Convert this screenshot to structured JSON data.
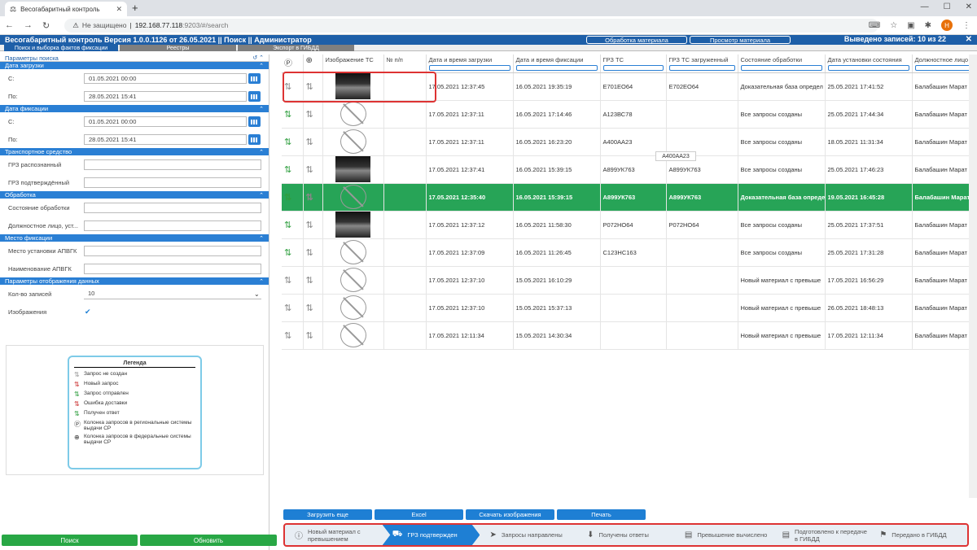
{
  "browser": {
    "tab_title": "Весогабаритный контроль",
    "security": "Не защищено",
    "url_host": "192.168.77.118",
    "url_path": ":9203/#/search",
    "avatar": "H"
  },
  "header": {
    "title": "Весогабаритный контроль Версия 1.0.0.1126 от 26.05.2021 || Поиск || Администратор",
    "btn_process": "Обработка материала",
    "btn_view": "Просмотр материала",
    "count": "Выведено записей: 10 из 22",
    "close": "✕"
  },
  "subtabs": [
    "Поиск и выборка фактов фиксации",
    "Реестры",
    "Экспорт в ГИБДД"
  ],
  "left": {
    "params_title": "Параметры поиска",
    "upload_section": "Дата загрузки",
    "from_label": "С:",
    "to_label": "По:",
    "upload_from": "01.05.2021 00:00",
    "upload_to": "28.05.2021 15:41",
    "fix_section": "Дата фиксации",
    "fix_from": "01.05.2021 00:00",
    "fix_to": "28.05.2021 15:41",
    "vehicle_section": "Транспортное средство",
    "grz_recognized": "ГРЗ распознанный",
    "grz_confirmed": "ГРЗ подтверждённый",
    "processing_section": "Обработка",
    "proc_state": "Состояние обработки",
    "official": "Должностное лицо, уст...",
    "place_section": "Место фиксации",
    "place_install": "Место установки АПВГК",
    "place_name": "Наименование АПВГК",
    "display_section": "Параметры отображения данных",
    "count_label": "Кол-во записей",
    "count_value": "10",
    "images_label": "Изображения",
    "legend_title": "Легенда",
    "legend": [
      "Запрос не создан",
      "Новый запрос",
      "Запрос отправлен",
      "Ошибка доставки",
      "Получен ответ",
      "Колонка запросов в региональные системы выдачи СР",
      "Колонка запросов в федеральные системы выдачи СР"
    ],
    "search_btn": "Поиск",
    "refresh_btn": "Обновить"
  },
  "table": {
    "columns": [
      "",
      "",
      "Изображение ТС",
      "№ п/п",
      "Дата и время загрузки",
      "Дата и время фиксации",
      "ГРЗ ТС",
      "ГРЗ ТС загруженный",
      "Состояние обработки",
      "Дата установки состояния",
      "Должностное лицо"
    ],
    "rows": [
      {
        "img": "photo",
        "a1": "",
        "a2": "",
        "load": "17.05.2021 12:37:45",
        "fix": "16.05.2021 19:35:19",
        "grz": "Е701ЕО64",
        "grz2": "Е702ЕО64",
        "state": "Доказательная база определ",
        "sdate": "25.05.2021 17:41:52",
        "off": "Балабашин Марат"
      },
      {
        "img": "none",
        "a1": "g",
        "a2": "",
        "load": "17.05.2021 12:37:11",
        "fix": "16.05.2021 17:14:46",
        "grz": "А123ВС78",
        "grz2": "",
        "state": "Все запросы созданы",
        "sdate": "25.05.2021 17:44:34",
        "off": "Балабашин Марат"
      },
      {
        "img": "none",
        "a1": "g",
        "a2": "",
        "load": "17.05.2021 12:37:11",
        "fix": "16.05.2021 16:23:20",
        "grz": "А400АА23",
        "grz2": "",
        "state": "Все запросы созданы",
        "sdate": "18.05.2021 11:31:34",
        "off": "Балабашин Марат"
      },
      {
        "img": "photo",
        "a1": "g",
        "a2": "",
        "load": "17.05.2021 12:37:41",
        "fix": "16.05.2021 15:39:15",
        "grz": "А899УК763",
        "grz2": "А899УК763",
        "state": "Все запросы созданы",
        "sdate": "25.05.2021 17:46:23",
        "off": "Балабашин Марат"
      },
      {
        "img": "none",
        "a1": "g",
        "a2": "",
        "load": "17.05.2021 12:35:40",
        "fix": "16.05.2021 15:39:15",
        "grz": "А899УК763",
        "grz2": "А899УК763",
        "state": "Доказательная база определ",
        "sdate": "19.05.2021 16:45:28",
        "off": "Балабашин Марат",
        "sel": true
      },
      {
        "img": "photo",
        "a1": "g",
        "a2": "",
        "load": "17.05.2021 12:37:12",
        "fix": "16.05.2021 11:58:30",
        "grz": "Р072НО64",
        "grz2": "Р072НО64",
        "state": "Все запросы созданы",
        "sdate": "25.05.2021 17:37:51",
        "off": "Балабашин Марат"
      },
      {
        "img": "none",
        "a1": "g",
        "a2": "",
        "load": "17.05.2021 12:37:09",
        "fix": "16.05.2021 11:26:45",
        "grz": "С123НС163",
        "grz2": "",
        "state": "Все запросы созданы",
        "sdate": "25.05.2021 17:31:28",
        "off": "Балабашин Марат"
      },
      {
        "img": "none",
        "a1": "",
        "a2": "",
        "load": "17.05.2021 12:37:10",
        "fix": "15.05.2021 16:10:29",
        "grz": "",
        "grz2": "",
        "state": "Новый материал с превыше",
        "sdate": "17.05.2021 16:56:29",
        "off": "Балабашин Марат"
      },
      {
        "img": "none",
        "a1": "",
        "a2": "",
        "load": "17.05.2021 12:37:10",
        "fix": "15.05.2021 15:37:13",
        "grz": "",
        "grz2": "",
        "state": "Новый материал с превыше",
        "sdate": "26.05.2021 18:48:13",
        "off": "Балабашин Марат"
      },
      {
        "img": "none",
        "a1": "",
        "a2": "",
        "load": "17.05.2021 12:11:34",
        "fix": "15.05.2021 14:30:34",
        "grz": "",
        "grz2": "",
        "state": "Новый материал с превыше",
        "sdate": "17.05.2021 12:11:34",
        "off": "Балабашин Марат"
      }
    ],
    "tooltip": "А400АА23"
  },
  "actions": [
    "Загрузить еще",
    "Excel",
    "Скачать изображения",
    "Печать"
  ],
  "steps": [
    {
      "icon": "ⓘ",
      "label": "Новый материал с превышением"
    },
    {
      "icon": "⛟",
      "label": "ГРЗ подтвержден",
      "on": true
    },
    {
      "icon": "➤",
      "label": "Запросы направлены"
    },
    {
      "icon": "⬇",
      "label": "Получены ответы"
    },
    {
      "icon": "▤",
      "label": "Превышение вычислено"
    },
    {
      "icon": "▤",
      "label": "Подготовлено к передаче в ГИБДД"
    },
    {
      "icon": "⚑",
      "label": "Передано в ГИБДД"
    }
  ]
}
